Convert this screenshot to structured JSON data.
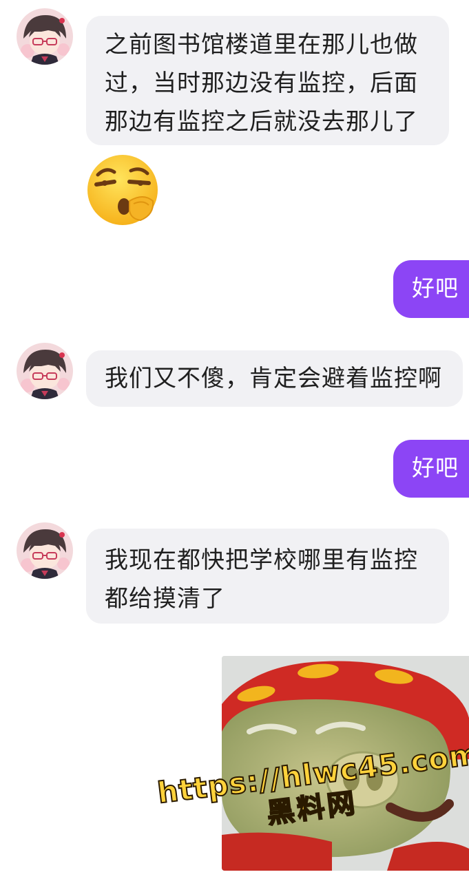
{
  "messages": [
    {
      "side": "in",
      "text": "之前图书馆楼道里在那儿也做过，当时那边没有监控，后面那边有监控之后就没去那儿了"
    },
    {
      "side": "in",
      "emoji": "shush-face-emoji"
    },
    {
      "side": "out",
      "text": "好吧"
    },
    {
      "side": "in",
      "text": "我们又不傻，肯定会避着监控啊"
    },
    {
      "side": "out",
      "text": "好吧"
    },
    {
      "side": "in",
      "text": "我现在都快把学校哪里有监控都给摸清了"
    },
    {
      "side": "out",
      "sticker": "laughing-pig-sticker"
    }
  ],
  "watermark": {
    "url": "https://hlwc45.com",
    "label": "黑料网"
  },
  "colors": {
    "incoming_bubble": "#f1f1f4",
    "outgoing_bubble": "#8c45f5",
    "background": "#ffffff",
    "watermark_fill": "#ffd23b"
  }
}
